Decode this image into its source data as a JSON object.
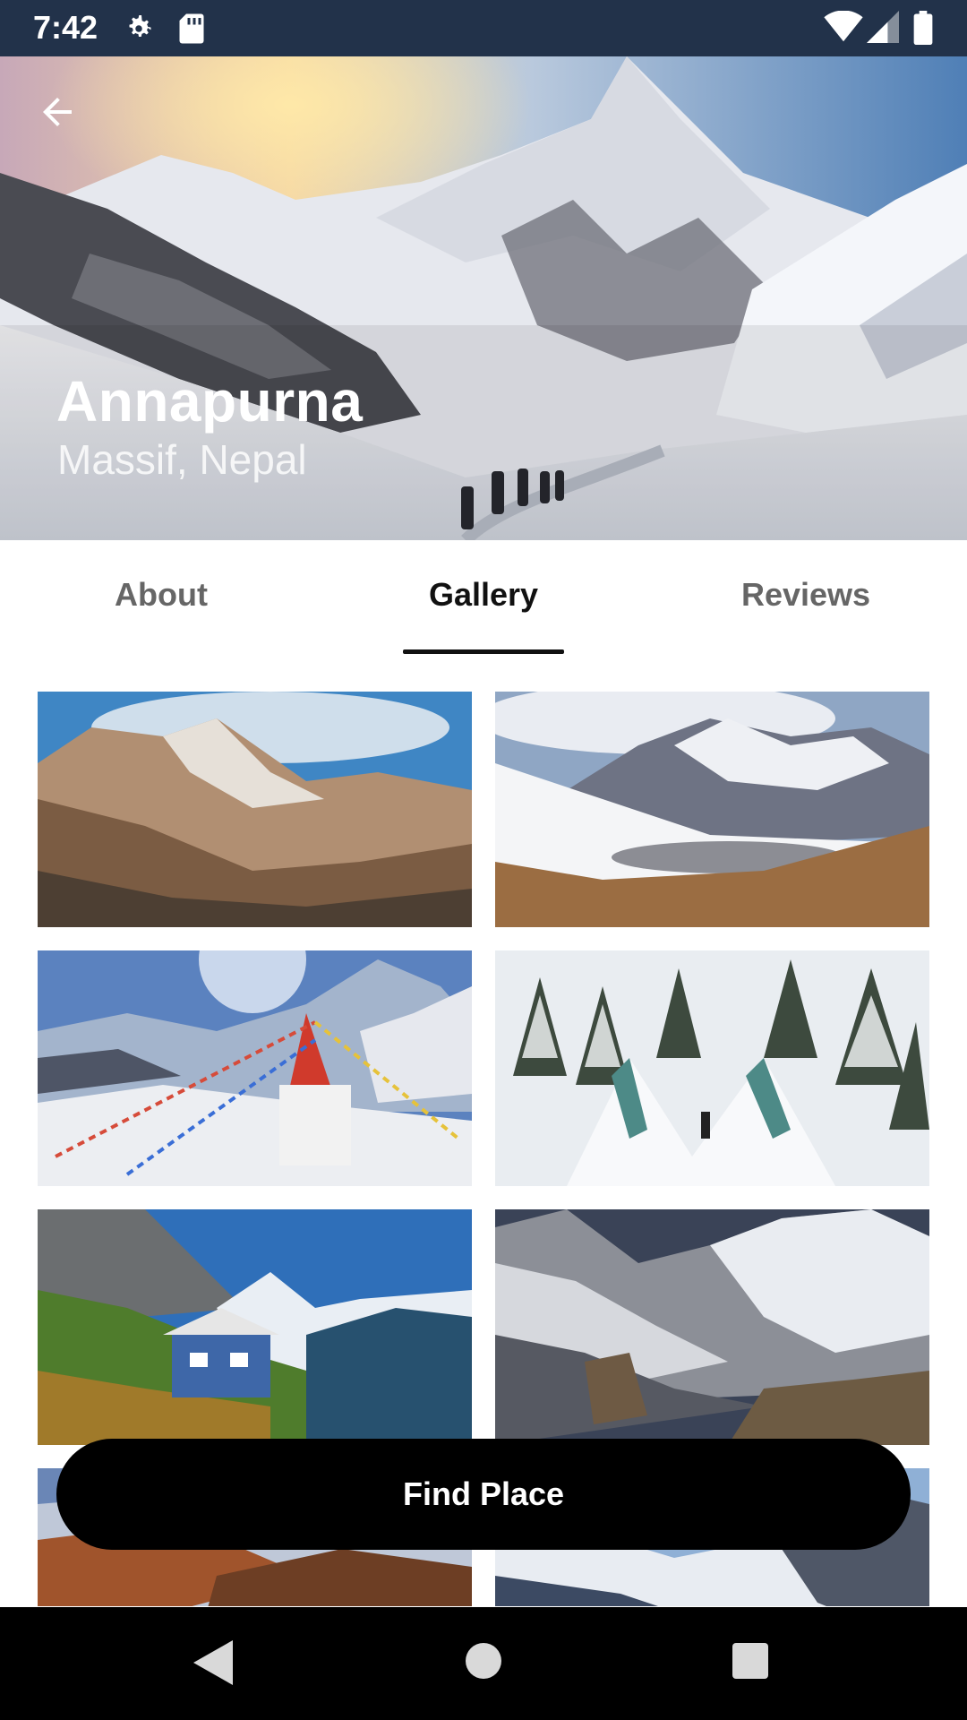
{
  "status_bar": {
    "time": "7:42",
    "icons": [
      "settings-gear-icon",
      "sd-card-icon",
      "wifi-icon",
      "cell-signal-icon",
      "battery-icon"
    ]
  },
  "hero": {
    "title": "Annapurna",
    "subtitle": "Massif, Nepal",
    "back_icon": "arrow-left-icon"
  },
  "tabs": {
    "items": [
      "About",
      "Gallery",
      "Reviews"
    ],
    "active": "Gallery"
  },
  "gallery": {
    "photos": [
      "mountain-valley-photo",
      "alpine-lake-photo",
      "prayer-flag-stupa-photo",
      "snowy-forest-bridge-photo",
      "mountain-village-house-photo",
      "rocky-glacier-photo",
      "autumn-range-photo",
      "snowy-peaks-photo"
    ]
  },
  "actions": {
    "find_place_label": "Find Place"
  },
  "nav_bar": {
    "icons": [
      "back-triangle-icon",
      "home-circle-icon",
      "recents-square-icon"
    ]
  },
  "colors": {
    "status_bar": "#22324a",
    "button": "#000000",
    "tab_active": "#111111",
    "tab_inactive": "#666666"
  }
}
